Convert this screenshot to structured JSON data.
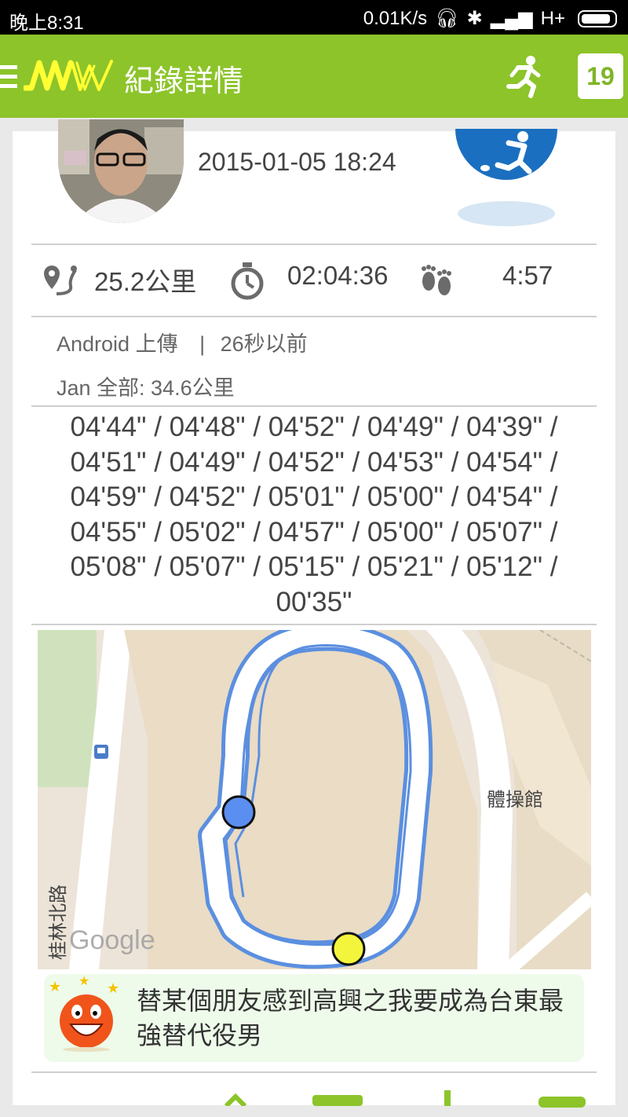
{
  "status_bar": {
    "time": "晚上8:31",
    "speed": "0.01K/s",
    "network": "H+"
  },
  "app_bar": {
    "logo_text": "MW",
    "title": "紀錄詳情",
    "badge": "19"
  },
  "record": {
    "datetime": "2015-01-05 18:24",
    "distance": "25.2公里",
    "duration": "02:04:36",
    "pace": "4:57",
    "upload_source": "Android 上傳",
    "separator": "|",
    "upload_time": "26秒以前",
    "month_total": "Jan 全部:  34.6公里",
    "splits": "04'44\" / 04'48\" / 04'52\" / 04'49\" / 04'39\" / 04'51\" / 04'49\" / 04'52\" / 04'53\" / 04'54\" / 04'59\" / 04'52\" / 05'01\" / 05'00\" / 04'54\" / 04'55\" / 05'02\" / 04'57\" / 05'00\" / 05'07\" / 05'08\" / 05'07\" / 05'15\" / 05'21\" / 05'12\" / 00'35\""
  },
  "map": {
    "road_label": "桂林北路",
    "building_label": "體操館",
    "watermark": "Google"
  },
  "message": {
    "text": "替某個朋友感到高興之我要成為台東最強替代役男"
  },
  "colors": {
    "app_bar": "#8cc42a",
    "route": "#5b8fe0",
    "start_marker": "#5a8ef0",
    "end_marker": "#f3f53c",
    "logo": "#ffff33"
  }
}
